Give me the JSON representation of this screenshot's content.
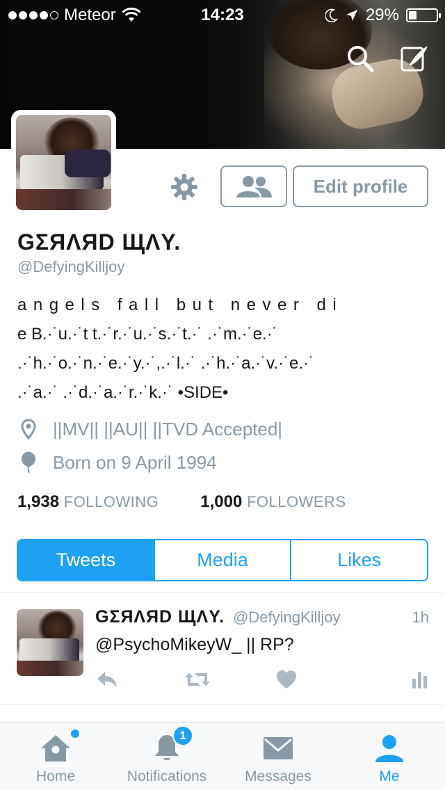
{
  "status_bar": {
    "carrier": "Meteor",
    "time": "14:23",
    "battery": "29%",
    "battery_level": 0.29,
    "signal_bars_filled": 4,
    "signal_bars_total": 5
  },
  "header": {
    "search_icon": "search-icon",
    "compose_icon": "compose-icon"
  },
  "profile": {
    "display_name": "GΣЯΛЯD ЩΛY.",
    "handle": "@DefyingKilljoy",
    "edit_profile_label": "Edit profile",
    "bio_lines": [
      "angels fall but never di",
      "e B.·˙u.·˙t t.·˙r.·˙u.·˙s.·˙t.·˙ .·˙m.·˙e.·˙",
      ".·˙h.·˙o.·˙n.·˙e.·˙y.·˙,.·˙l.·˙ .·˙h.·˙a.·˙v.·˙e.·˙",
      ".·˙a.·˙ .·˙d.·˙a.·˙r.·˙k.·˙ •SIDE•"
    ],
    "location": "||MV|| ||AU|| ||TVD Accepted|",
    "birthday": "Born on 9 April 1994",
    "following_count": "1,938",
    "following_label": "FOLLOWING",
    "followers_count": "1,000",
    "followers_label": "FOLLOWERS"
  },
  "tabs": [
    {
      "label": "Tweets",
      "active": true
    },
    {
      "label": "Media",
      "active": false
    },
    {
      "label": "Likes",
      "active": false
    }
  ],
  "tweet": {
    "author_name": "GΣЯΛЯD ЩΛY.",
    "author_handle": "@DefyingKilljoy",
    "time": "1h",
    "text": "@PsychoMikeyW_ || RP?"
  },
  "tabbar": {
    "home": "Home",
    "notifications": "Notifications",
    "notifications_badge": "1",
    "messages": "Messages",
    "me": "Me"
  },
  "colors": {
    "accent": "#1da1f2",
    "muted": "#8899a6",
    "text": "#14171a"
  }
}
